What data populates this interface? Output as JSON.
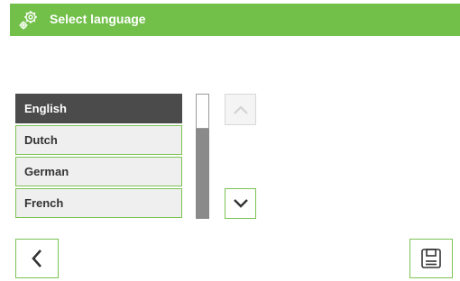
{
  "header": {
    "title": "Select language",
    "icon": "gear-icon",
    "color": "#72c04a"
  },
  "languages": {
    "selected_index": 0,
    "items": [
      {
        "label": "English"
      },
      {
        "label": "Dutch"
      },
      {
        "label": "German"
      },
      {
        "label": "French"
      }
    ]
  },
  "controls": {
    "scroll_up": {
      "icon": "chevron-up-icon",
      "enabled": false
    },
    "scroll_down": {
      "icon": "chevron-down-icon",
      "enabled": true
    },
    "back": {
      "icon": "chevron-left-icon"
    },
    "save": {
      "icon": "floppy-disk-icon"
    }
  }
}
